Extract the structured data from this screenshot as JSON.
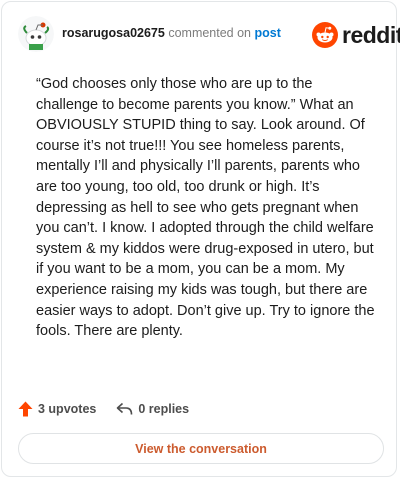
{
  "header": {
    "username": "rosarugosa02675",
    "action_text": "commented on",
    "target_link": "post",
    "brand": "reddit"
  },
  "comment": {
    "text": "“God chooses only those who are up to the challenge to become parents you know.” What an OBVIOUSLY STUPID thing to say. Look around. Of course it’s not true!!! You see homeless parents, mentally I’ll and physically I’ll parents, parents who are too young, too old, too drunk or high. It’s depressing as hell to see who gets pregnant when you can’t. I know. I adopted through the child welfare system & my kiddos were drug-exposed in utero, but if you want to be a mom, you can be a mom. My experience raising my kids was tough, but there are easier ways to adopt. Don’t give up. Try to ignore the fools. There are plenty."
  },
  "footer": {
    "upvotes": "3 upvotes",
    "replies": "0 replies",
    "view_button": "View the conversation"
  },
  "colors": {
    "brand_orange": "#ff4500",
    "link_blue": "#0079d3",
    "button_text": "#cc5b2e"
  }
}
